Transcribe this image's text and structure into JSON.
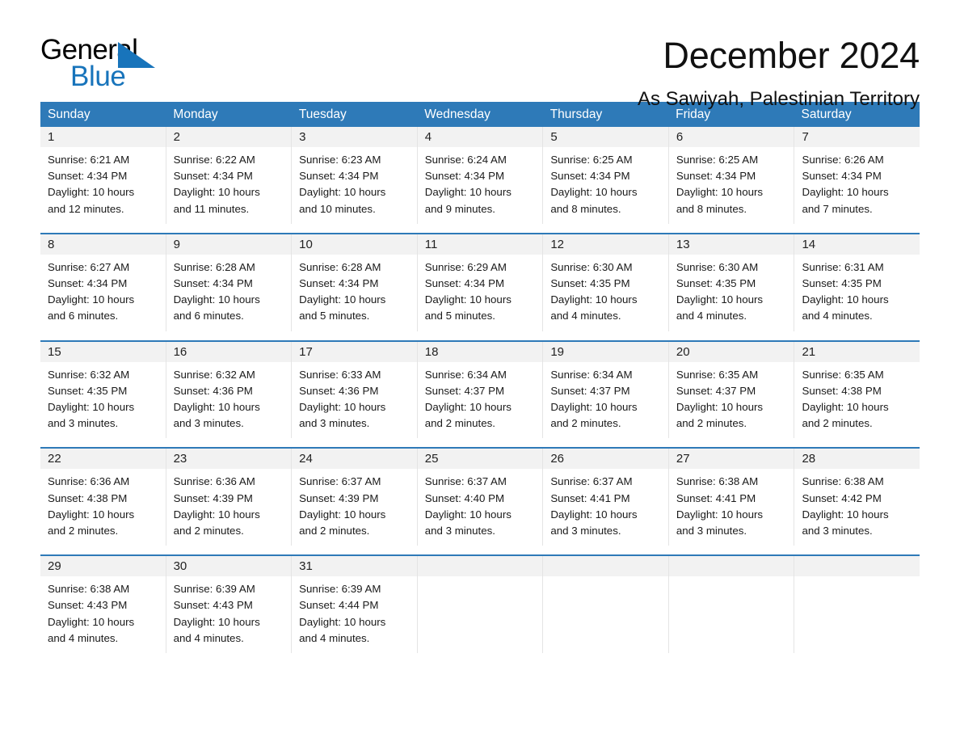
{
  "brand": {
    "name_part1": "General",
    "name_part2": "Blue",
    "accent_color": "#1874bb"
  },
  "header": {
    "month_title": "December 2024",
    "location": "As Sawiyah, Palestinian Territory"
  },
  "calendar": {
    "header_color": "#2e7ab8",
    "weekdays": [
      "Sunday",
      "Monday",
      "Tuesday",
      "Wednesday",
      "Thursday",
      "Friday",
      "Saturday"
    ],
    "weeks": [
      [
        {
          "day": "1",
          "lines": [
            "Sunrise: 6:21 AM",
            "Sunset: 4:34 PM",
            "Daylight: 10 hours",
            "and 12 minutes."
          ]
        },
        {
          "day": "2",
          "lines": [
            "Sunrise: 6:22 AM",
            "Sunset: 4:34 PM",
            "Daylight: 10 hours",
            "and 11 minutes."
          ]
        },
        {
          "day": "3",
          "lines": [
            "Sunrise: 6:23 AM",
            "Sunset: 4:34 PM",
            "Daylight: 10 hours",
            "and 10 minutes."
          ]
        },
        {
          "day": "4",
          "lines": [
            "Sunrise: 6:24 AM",
            "Sunset: 4:34 PM",
            "Daylight: 10 hours",
            "and 9 minutes."
          ]
        },
        {
          "day": "5",
          "lines": [
            "Sunrise: 6:25 AM",
            "Sunset: 4:34 PM",
            "Daylight: 10 hours",
            "and 8 minutes."
          ]
        },
        {
          "day": "6",
          "lines": [
            "Sunrise: 6:25 AM",
            "Sunset: 4:34 PM",
            "Daylight: 10 hours",
            "and 8 minutes."
          ]
        },
        {
          "day": "7",
          "lines": [
            "Sunrise: 6:26 AM",
            "Sunset: 4:34 PM",
            "Daylight: 10 hours",
            "and 7 minutes."
          ]
        }
      ],
      [
        {
          "day": "8",
          "lines": [
            "Sunrise: 6:27 AM",
            "Sunset: 4:34 PM",
            "Daylight: 10 hours",
            "and 6 minutes."
          ]
        },
        {
          "day": "9",
          "lines": [
            "Sunrise: 6:28 AM",
            "Sunset: 4:34 PM",
            "Daylight: 10 hours",
            "and 6 minutes."
          ]
        },
        {
          "day": "10",
          "lines": [
            "Sunrise: 6:28 AM",
            "Sunset: 4:34 PM",
            "Daylight: 10 hours",
            "and 5 minutes."
          ]
        },
        {
          "day": "11",
          "lines": [
            "Sunrise: 6:29 AM",
            "Sunset: 4:34 PM",
            "Daylight: 10 hours",
            "and 5 minutes."
          ]
        },
        {
          "day": "12",
          "lines": [
            "Sunrise: 6:30 AM",
            "Sunset: 4:35 PM",
            "Daylight: 10 hours",
            "and 4 minutes."
          ]
        },
        {
          "day": "13",
          "lines": [
            "Sunrise: 6:30 AM",
            "Sunset: 4:35 PM",
            "Daylight: 10 hours",
            "and 4 minutes."
          ]
        },
        {
          "day": "14",
          "lines": [
            "Sunrise: 6:31 AM",
            "Sunset: 4:35 PM",
            "Daylight: 10 hours",
            "and 4 minutes."
          ]
        }
      ],
      [
        {
          "day": "15",
          "lines": [
            "Sunrise: 6:32 AM",
            "Sunset: 4:35 PM",
            "Daylight: 10 hours",
            "and 3 minutes."
          ]
        },
        {
          "day": "16",
          "lines": [
            "Sunrise: 6:32 AM",
            "Sunset: 4:36 PM",
            "Daylight: 10 hours",
            "and 3 minutes."
          ]
        },
        {
          "day": "17",
          "lines": [
            "Sunrise: 6:33 AM",
            "Sunset: 4:36 PM",
            "Daylight: 10 hours",
            "and 3 minutes."
          ]
        },
        {
          "day": "18",
          "lines": [
            "Sunrise: 6:34 AM",
            "Sunset: 4:37 PM",
            "Daylight: 10 hours",
            "and 2 minutes."
          ]
        },
        {
          "day": "19",
          "lines": [
            "Sunrise: 6:34 AM",
            "Sunset: 4:37 PM",
            "Daylight: 10 hours",
            "and 2 minutes."
          ]
        },
        {
          "day": "20",
          "lines": [
            "Sunrise: 6:35 AM",
            "Sunset: 4:37 PM",
            "Daylight: 10 hours",
            "and 2 minutes."
          ]
        },
        {
          "day": "21",
          "lines": [
            "Sunrise: 6:35 AM",
            "Sunset: 4:38 PM",
            "Daylight: 10 hours",
            "and 2 minutes."
          ]
        }
      ],
      [
        {
          "day": "22",
          "lines": [
            "Sunrise: 6:36 AM",
            "Sunset: 4:38 PM",
            "Daylight: 10 hours",
            "and 2 minutes."
          ]
        },
        {
          "day": "23",
          "lines": [
            "Sunrise: 6:36 AM",
            "Sunset: 4:39 PM",
            "Daylight: 10 hours",
            "and 2 minutes."
          ]
        },
        {
          "day": "24",
          "lines": [
            "Sunrise: 6:37 AM",
            "Sunset: 4:39 PM",
            "Daylight: 10 hours",
            "and 2 minutes."
          ]
        },
        {
          "day": "25",
          "lines": [
            "Sunrise: 6:37 AM",
            "Sunset: 4:40 PM",
            "Daylight: 10 hours",
            "and 3 minutes."
          ]
        },
        {
          "day": "26",
          "lines": [
            "Sunrise: 6:37 AM",
            "Sunset: 4:41 PM",
            "Daylight: 10 hours",
            "and 3 minutes."
          ]
        },
        {
          "day": "27",
          "lines": [
            "Sunrise: 6:38 AM",
            "Sunset: 4:41 PM",
            "Daylight: 10 hours",
            "and 3 minutes."
          ]
        },
        {
          "day": "28",
          "lines": [
            "Sunrise: 6:38 AM",
            "Sunset: 4:42 PM",
            "Daylight: 10 hours",
            "and 3 minutes."
          ]
        }
      ],
      [
        {
          "day": "29",
          "lines": [
            "Sunrise: 6:38 AM",
            "Sunset: 4:43 PM",
            "Daylight: 10 hours",
            "and 4 minutes."
          ]
        },
        {
          "day": "30",
          "lines": [
            "Sunrise: 6:39 AM",
            "Sunset: 4:43 PM",
            "Daylight: 10 hours",
            "and 4 minutes."
          ]
        },
        {
          "day": "31",
          "lines": [
            "Sunrise: 6:39 AM",
            "Sunset: 4:44 PM",
            "Daylight: 10 hours",
            "and 4 minutes."
          ]
        },
        {
          "day": "",
          "lines": []
        },
        {
          "day": "",
          "lines": []
        },
        {
          "day": "",
          "lines": []
        },
        {
          "day": "",
          "lines": []
        }
      ]
    ]
  }
}
